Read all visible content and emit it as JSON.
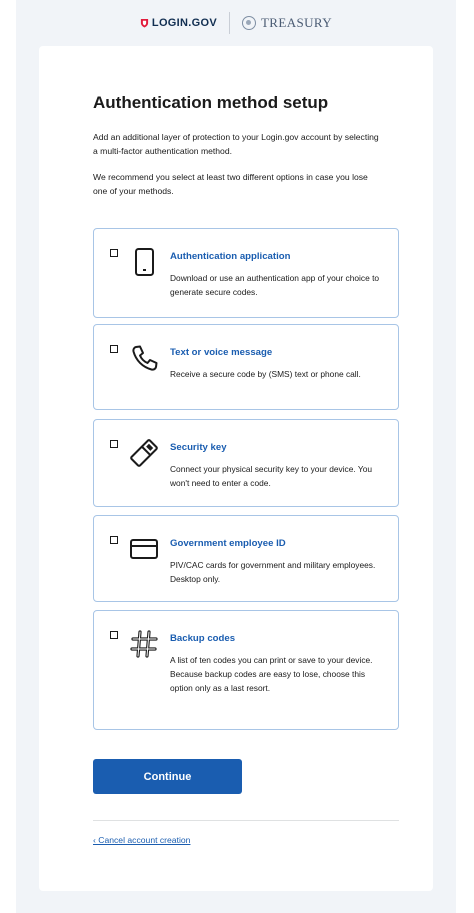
{
  "header": {
    "login_logo_text": "LOGIN.GOV",
    "partner_text": "TREASURY"
  },
  "main": {
    "title": "Authentication method setup",
    "intro_1": "Add an additional layer of protection to your Login.gov account by selecting a multi-factor authentication method.",
    "intro_2": "We recommend you select at least two different options in case you lose one of your methods.",
    "options": [
      {
        "icon": "phone-device-icon",
        "title": "Authentication application",
        "description": "Download or use an authentication app of your choice to generate secure codes.",
        "checked": false
      },
      {
        "icon": "phone-call-icon",
        "title": "Text or voice message",
        "description": "Receive a secure code by (SMS) text or phone call.",
        "checked": false
      },
      {
        "icon": "security-key-icon",
        "title": "Security key",
        "description": "Connect your physical security key to your device. You won't need to enter a code.",
        "checked": false
      },
      {
        "icon": "id-card-icon",
        "title": "Government employee ID",
        "description": "PIV/CAC cards for government and military employees. Desktop only.",
        "checked": false
      },
      {
        "icon": "hashtag-icon",
        "title": "Backup codes",
        "description": "A list of ten codes you can print or save to your device. Because backup codes are easy to lose, choose this option only as a last resort.",
        "checked": false
      }
    ],
    "continue_label": "Continue",
    "cancel_label": "‹ Cancel account creation"
  },
  "colors": {
    "accent": "#1a5db0",
    "option_border": "#a8c5e6",
    "brand_red": "#e21c3d",
    "page_bg": "#f1f4f8"
  }
}
